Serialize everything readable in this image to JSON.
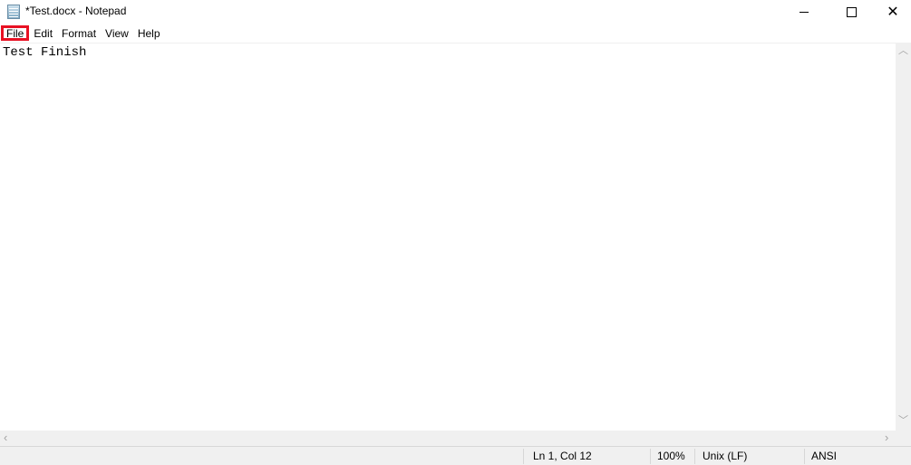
{
  "window": {
    "title": "*Test.docx - Notepad",
    "icon": "notepad-icon",
    "controls": {
      "minimize": "minimize-icon",
      "maximize": "maximize-icon",
      "close": "close-icon"
    }
  },
  "menu": {
    "items": [
      {
        "label": "File",
        "highlighted": true
      },
      {
        "label": "Edit"
      },
      {
        "label": "Format"
      },
      {
        "label": "View"
      },
      {
        "label": "Help"
      }
    ]
  },
  "editor": {
    "content": "Test Finish"
  },
  "statusbar": {
    "position": "Ln 1, Col 12",
    "zoom": "100%",
    "line_ending": "Unix (LF)",
    "encoding": "ANSI"
  },
  "colors": {
    "highlight": "#e81123"
  }
}
